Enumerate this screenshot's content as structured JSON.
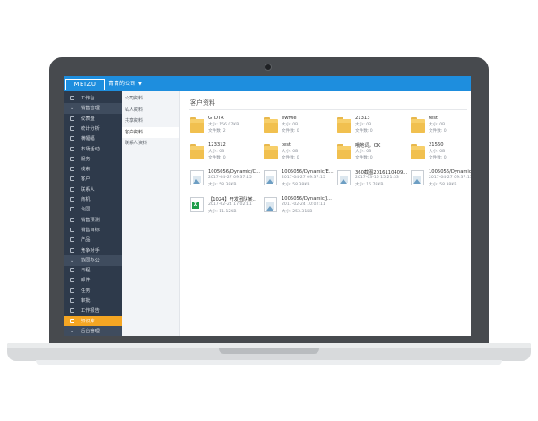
{
  "header": {
    "logo": "MEIZU",
    "company": "青青的公司"
  },
  "sidebar": {
    "items": [
      {
        "label": "工作台",
        "kind": "item",
        "icon": "home-icon"
      },
      {
        "label": "销售管理",
        "kind": "group"
      },
      {
        "label": "仪表盘",
        "kind": "item",
        "icon": "dashboard-icon"
      },
      {
        "label": "统计分析",
        "kind": "item",
        "icon": "chart-icon"
      },
      {
        "label": "横幅幅",
        "kind": "item",
        "icon": "banner-icon"
      },
      {
        "label": "市场活动",
        "kind": "item",
        "icon": "campaign-icon"
      },
      {
        "label": "服务",
        "kind": "item",
        "icon": "service-icon"
      },
      {
        "label": "线索",
        "kind": "item",
        "icon": "lead-icon"
      },
      {
        "label": "客户",
        "kind": "item",
        "icon": "customer-icon"
      },
      {
        "label": "联系人",
        "kind": "item",
        "icon": "contact-icon"
      },
      {
        "label": "商机",
        "kind": "item",
        "icon": "opportunity-icon"
      },
      {
        "label": "合同",
        "kind": "item",
        "icon": "contract-icon"
      },
      {
        "label": "销售预测",
        "kind": "item",
        "icon": "forecast-icon"
      },
      {
        "label": "销售目标",
        "kind": "item",
        "icon": "target-icon"
      },
      {
        "label": "产品",
        "kind": "item",
        "icon": "product-icon"
      },
      {
        "label": "竞争对手",
        "kind": "item",
        "icon": "competitor-icon"
      },
      {
        "label": "协同办公",
        "kind": "group"
      },
      {
        "label": "日程",
        "kind": "item",
        "icon": "calendar-icon"
      },
      {
        "label": "邮件",
        "kind": "item",
        "icon": "mail-icon"
      },
      {
        "label": "任务",
        "kind": "item",
        "icon": "task-icon"
      },
      {
        "label": "审批",
        "kind": "item",
        "icon": "approval-icon"
      },
      {
        "label": "工作报告",
        "kind": "item",
        "icon": "report-icon"
      },
      {
        "label": "知识库",
        "kind": "item",
        "icon": "knowledge-icon",
        "active": true
      },
      {
        "label": "后台管理",
        "kind": "group"
      }
    ]
  },
  "subnav": {
    "items": [
      {
        "label": "公司资料"
      },
      {
        "label": "私人资料"
      },
      {
        "label": "共享资料"
      },
      {
        "label": "客户资料",
        "selected": true
      },
      {
        "label": "联系人资料"
      }
    ]
  },
  "main": {
    "title": "客户资料",
    "files": [
      {
        "type": "folder",
        "name": "GTDTR",
        "line2": "大小: 156.07KB",
        "line3": "文件数: 2"
      },
      {
        "type": "folder",
        "name": "ewfwe",
        "line2": "大小: 0B",
        "line3": "文件数: 0"
      },
      {
        "type": "folder",
        "name": "21313",
        "line2": "大小: 0B",
        "line3": "文件数: 0"
      },
      {
        "type": "folder",
        "name": "test",
        "line2": "大小: 0B",
        "line3": "文件数: 0"
      },
      {
        "type": "folder",
        "name": "123312",
        "line2": "大小: 0B",
        "line3": "文件数: 0"
      },
      {
        "type": "folder",
        "name": "test",
        "line2": "大小: 0B",
        "line3": "文件数: 0"
      },
      {
        "type": "folder",
        "name": "哦地词，OK",
        "line2": "大小: 0B",
        "line3": "文件数: 0"
      },
      {
        "type": "folder",
        "name": "21560",
        "line2": "大小: 0B",
        "line3": "文件数: 0"
      },
      {
        "type": "image",
        "name": "1005056/Dynamic/C...",
        "line2": "2017-04-27 09:37:15",
        "line3": "大小: 58.38KB"
      },
      {
        "type": "image",
        "name": "1005056/Dynamic/E...",
        "line2": "2017-04-27 09:37:15",
        "line3": "大小: 58.38KB"
      },
      {
        "type": "image",
        "name": "360截图20161104​09...",
        "line2": "2017-03-16 15:21:33",
        "line3": "大小: 16.78KB"
      },
      {
        "type": "image",
        "name": "1005056/Dynamic/C...",
        "line2": "2017-04-27 09:37:15",
        "line3": "大小: 58.38KB"
      },
      {
        "type": "excel",
        "name": "【1024】开发团队某...",
        "line2": "2017-02-24 17:02:11",
        "line3": "大小: 11.12KB"
      },
      {
        "type": "image",
        "name": "1005056/Dynamic/J...",
        "line2": "2017-02-24 10:02:11",
        "line3": "大小: 253.31KB"
      }
    ]
  }
}
